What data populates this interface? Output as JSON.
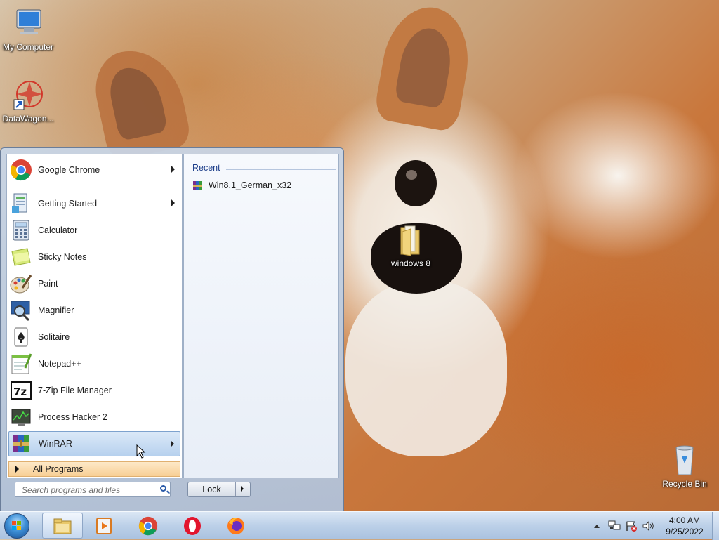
{
  "desktop": {
    "icons": [
      {
        "label": "My Computer",
        "icon": "my-computer-icon"
      },
      {
        "label": "DataWagon...",
        "icon": "datawagon-shortcut-icon"
      },
      {
        "label": "windows 8",
        "icon": "folder-icon"
      },
      {
        "label": "Recycle Bin",
        "icon": "recycle-bin-icon"
      }
    ]
  },
  "start_menu": {
    "programs": [
      {
        "label": "Google Chrome",
        "icon": "chrome-icon",
        "has_submenu": true
      },
      {
        "label": "Getting Started",
        "icon": "getting-started-icon",
        "has_submenu": true
      },
      {
        "label": "Calculator",
        "icon": "calculator-icon",
        "has_submenu": false
      },
      {
        "label": "Sticky Notes",
        "icon": "sticky-notes-icon",
        "has_submenu": false
      },
      {
        "label": "Paint",
        "icon": "paint-icon",
        "has_submenu": false
      },
      {
        "label": "Magnifier",
        "icon": "magnifier-icon",
        "has_submenu": false
      },
      {
        "label": "Solitaire",
        "icon": "solitaire-icon",
        "has_submenu": false
      },
      {
        "label": "Notepad++",
        "icon": "notepadpp-icon",
        "has_submenu": false
      },
      {
        "label": "7-Zip File Manager",
        "icon": "7zip-icon",
        "has_submenu": false
      },
      {
        "label": "Process Hacker 2",
        "icon": "process-hacker-icon",
        "has_submenu": false
      },
      {
        "label": "WinRAR",
        "icon": "winrar-icon",
        "has_submenu": true,
        "highlighted": true
      }
    ],
    "all_programs_label": "All Programs",
    "recent": {
      "heading": "Recent",
      "items": [
        {
          "label": "Win8.1_German_x32",
          "icon": "winrar-archive-icon"
        }
      ]
    },
    "search": {
      "placeholder": "Search programs and files",
      "value": ""
    },
    "lock_button_label": "Lock"
  },
  "taskbar": {
    "pinned": [
      {
        "name": "explorer",
        "icon": "explorer-icon",
        "active": true
      },
      {
        "name": "media-player",
        "icon": "media-player-icon",
        "active": false
      },
      {
        "name": "chrome",
        "icon": "chrome-icon",
        "active": false
      },
      {
        "name": "opera",
        "icon": "opera-icon",
        "active": false
      },
      {
        "name": "firefox",
        "icon": "firefox-icon",
        "active": false
      }
    ],
    "clock": {
      "time": "4:00 AM",
      "date": "9/25/2022"
    }
  }
}
